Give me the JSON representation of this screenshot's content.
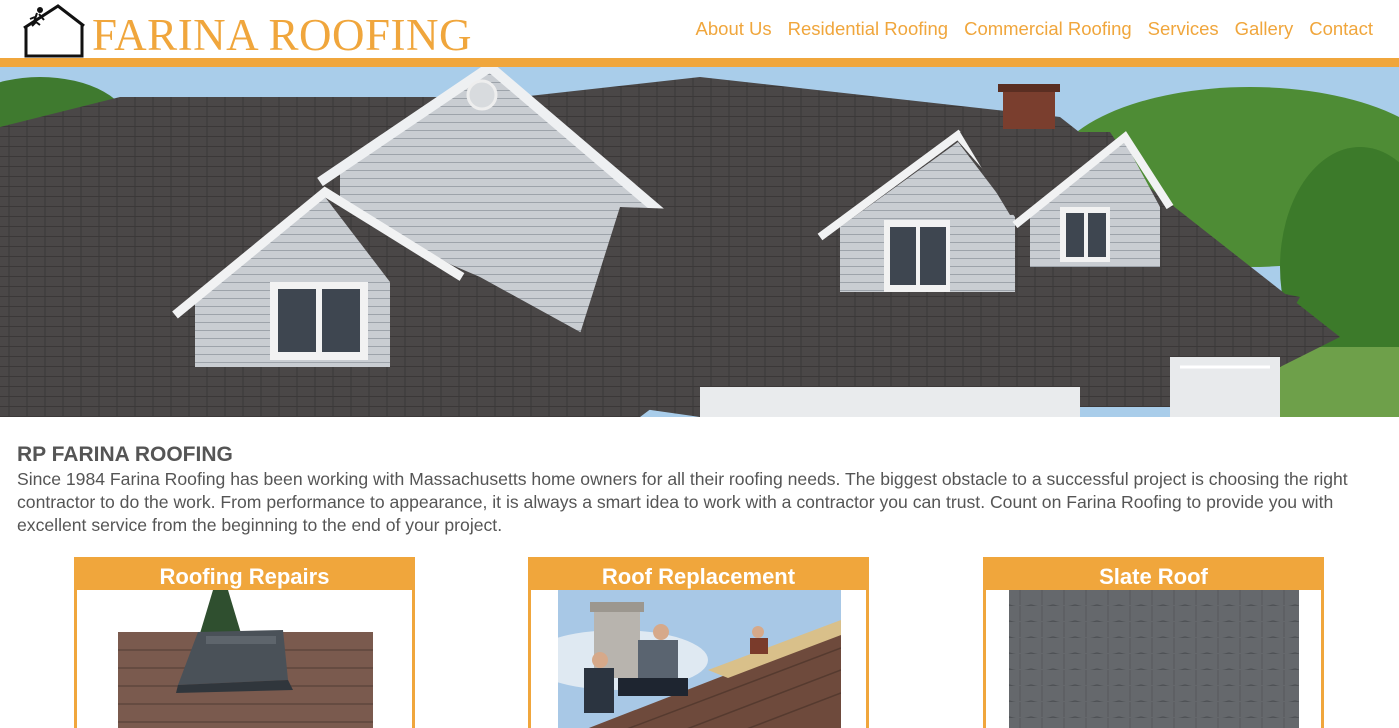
{
  "brand": {
    "logo_text": "FARINA ROOFING",
    "logo_icon": "house-roofer-icon",
    "accent": "#f0a63c"
  },
  "nav": [
    {
      "label": "About Us"
    },
    {
      "label": "Residential Roofing"
    },
    {
      "label": "Commercial Roofing"
    },
    {
      "label": "Services"
    },
    {
      "label": "Gallery"
    },
    {
      "label": "Contact"
    }
  ],
  "intro": {
    "heading": "RP FARINA ROOFING",
    "body": "Since 1984 Farina Roofing has been working with Massachusetts home owners for all their roofing needs. The biggest obstacle to a successful project is choosing the right contractor to do the work. From performance to appearance, it is always a smart idea to work with a contractor you can trust. Count on Farina Roofing to provide you with excellent service from the beginning to the end of your project."
  },
  "cards": [
    {
      "title": "Roofing Repairs"
    },
    {
      "title": "Roof Replacement"
    },
    {
      "title": "Slate Roof"
    }
  ]
}
